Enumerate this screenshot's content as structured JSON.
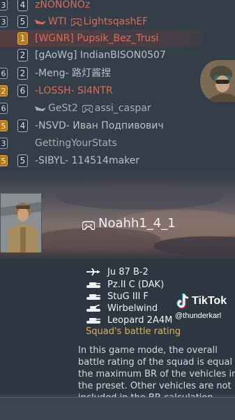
{
  "players": [
    {
      "left_badge": "3",
      "rank": "4",
      "rank_gold": false,
      "prefix": "",
      "name": "zNONONOz",
      "style": "red"
    },
    {
      "left_badge": "3",
      "rank": "5",
      "rank_gold": false,
      "prefix": "WTI",
      "name": "LightsqashEF",
      "style": "red",
      "gamepad": true
    },
    {
      "left_badge": "",
      "rank": "1",
      "rank_gold": true,
      "prefix": "",
      "name": "[WGNR] Pupsik_Bez_Trusi",
      "style": "red",
      "highlight": true
    },
    {
      "left_badge": "",
      "rank": "2",
      "rank_gold": false,
      "prefix": "",
      "name": "[gAoWg] IndianBISON0507",
      "style": "grey"
    },
    {
      "left_badge": "6",
      "rank": "2",
      "rank_gold": false,
      "prefix": "",
      "name": "-Meng- 路灯酱捏",
      "style": "grey"
    },
    {
      "left_badge": "2",
      "rank": "6",
      "rank_gold": false,
      "prefix": "",
      "name": "-LOSSH- Sl4NTR",
      "style": "red",
      "left_gold": true
    },
    {
      "left_badge": "6",
      "rank": "",
      "rank_gold": false,
      "prefix": "GeSt2",
      "name": "assi_caspar",
      "style": "grey2",
      "gamepad": true
    },
    {
      "left_badge": "5",
      "rank": "4",
      "rank_gold": false,
      "prefix": "",
      "name": "-NSVD- Иван Подпивович",
      "style": "grey",
      "left_gold": true
    },
    {
      "left_badge": "3",
      "rank": "",
      "rank_gold": false,
      "prefix": "",
      "name": "GettingYourStats",
      "style": "grey2"
    },
    {
      "left_badge": "5",
      "rank": "5",
      "rank_gold": false,
      "prefix": "",
      "name": "-SIBYL- 114514maker",
      "style": "grey",
      "left_gold": true
    }
  ],
  "squad": {
    "player_name": "Noahh1_4_1",
    "vehicles": [
      {
        "type": "plane-icon",
        "name": "Ju 87 B-2"
      },
      {
        "type": "tank-icon",
        "name": "Pz.II C (DAK)"
      },
      {
        "type": "tank-icon",
        "name": "StuG III F"
      },
      {
        "type": "spaa-icon",
        "name": "Wirbelwind"
      },
      {
        "type": "tank-icon",
        "name": "Leopard 2A4M"
      }
    ],
    "rating_label": "Squad's battle rating",
    "description": "In this game mode, the overall battle rating of the squad is equal to the maximum BR of the vehicles in the preset. Other vehicles are not included in the BR calculation."
  },
  "watermark": {
    "brand": "TikTok",
    "user": "@thunderkarl"
  },
  "colors": {
    "enemy_red": "#dd6a5a",
    "rating_gold": "#e4b04c",
    "badge_gold": "#b87a18"
  }
}
